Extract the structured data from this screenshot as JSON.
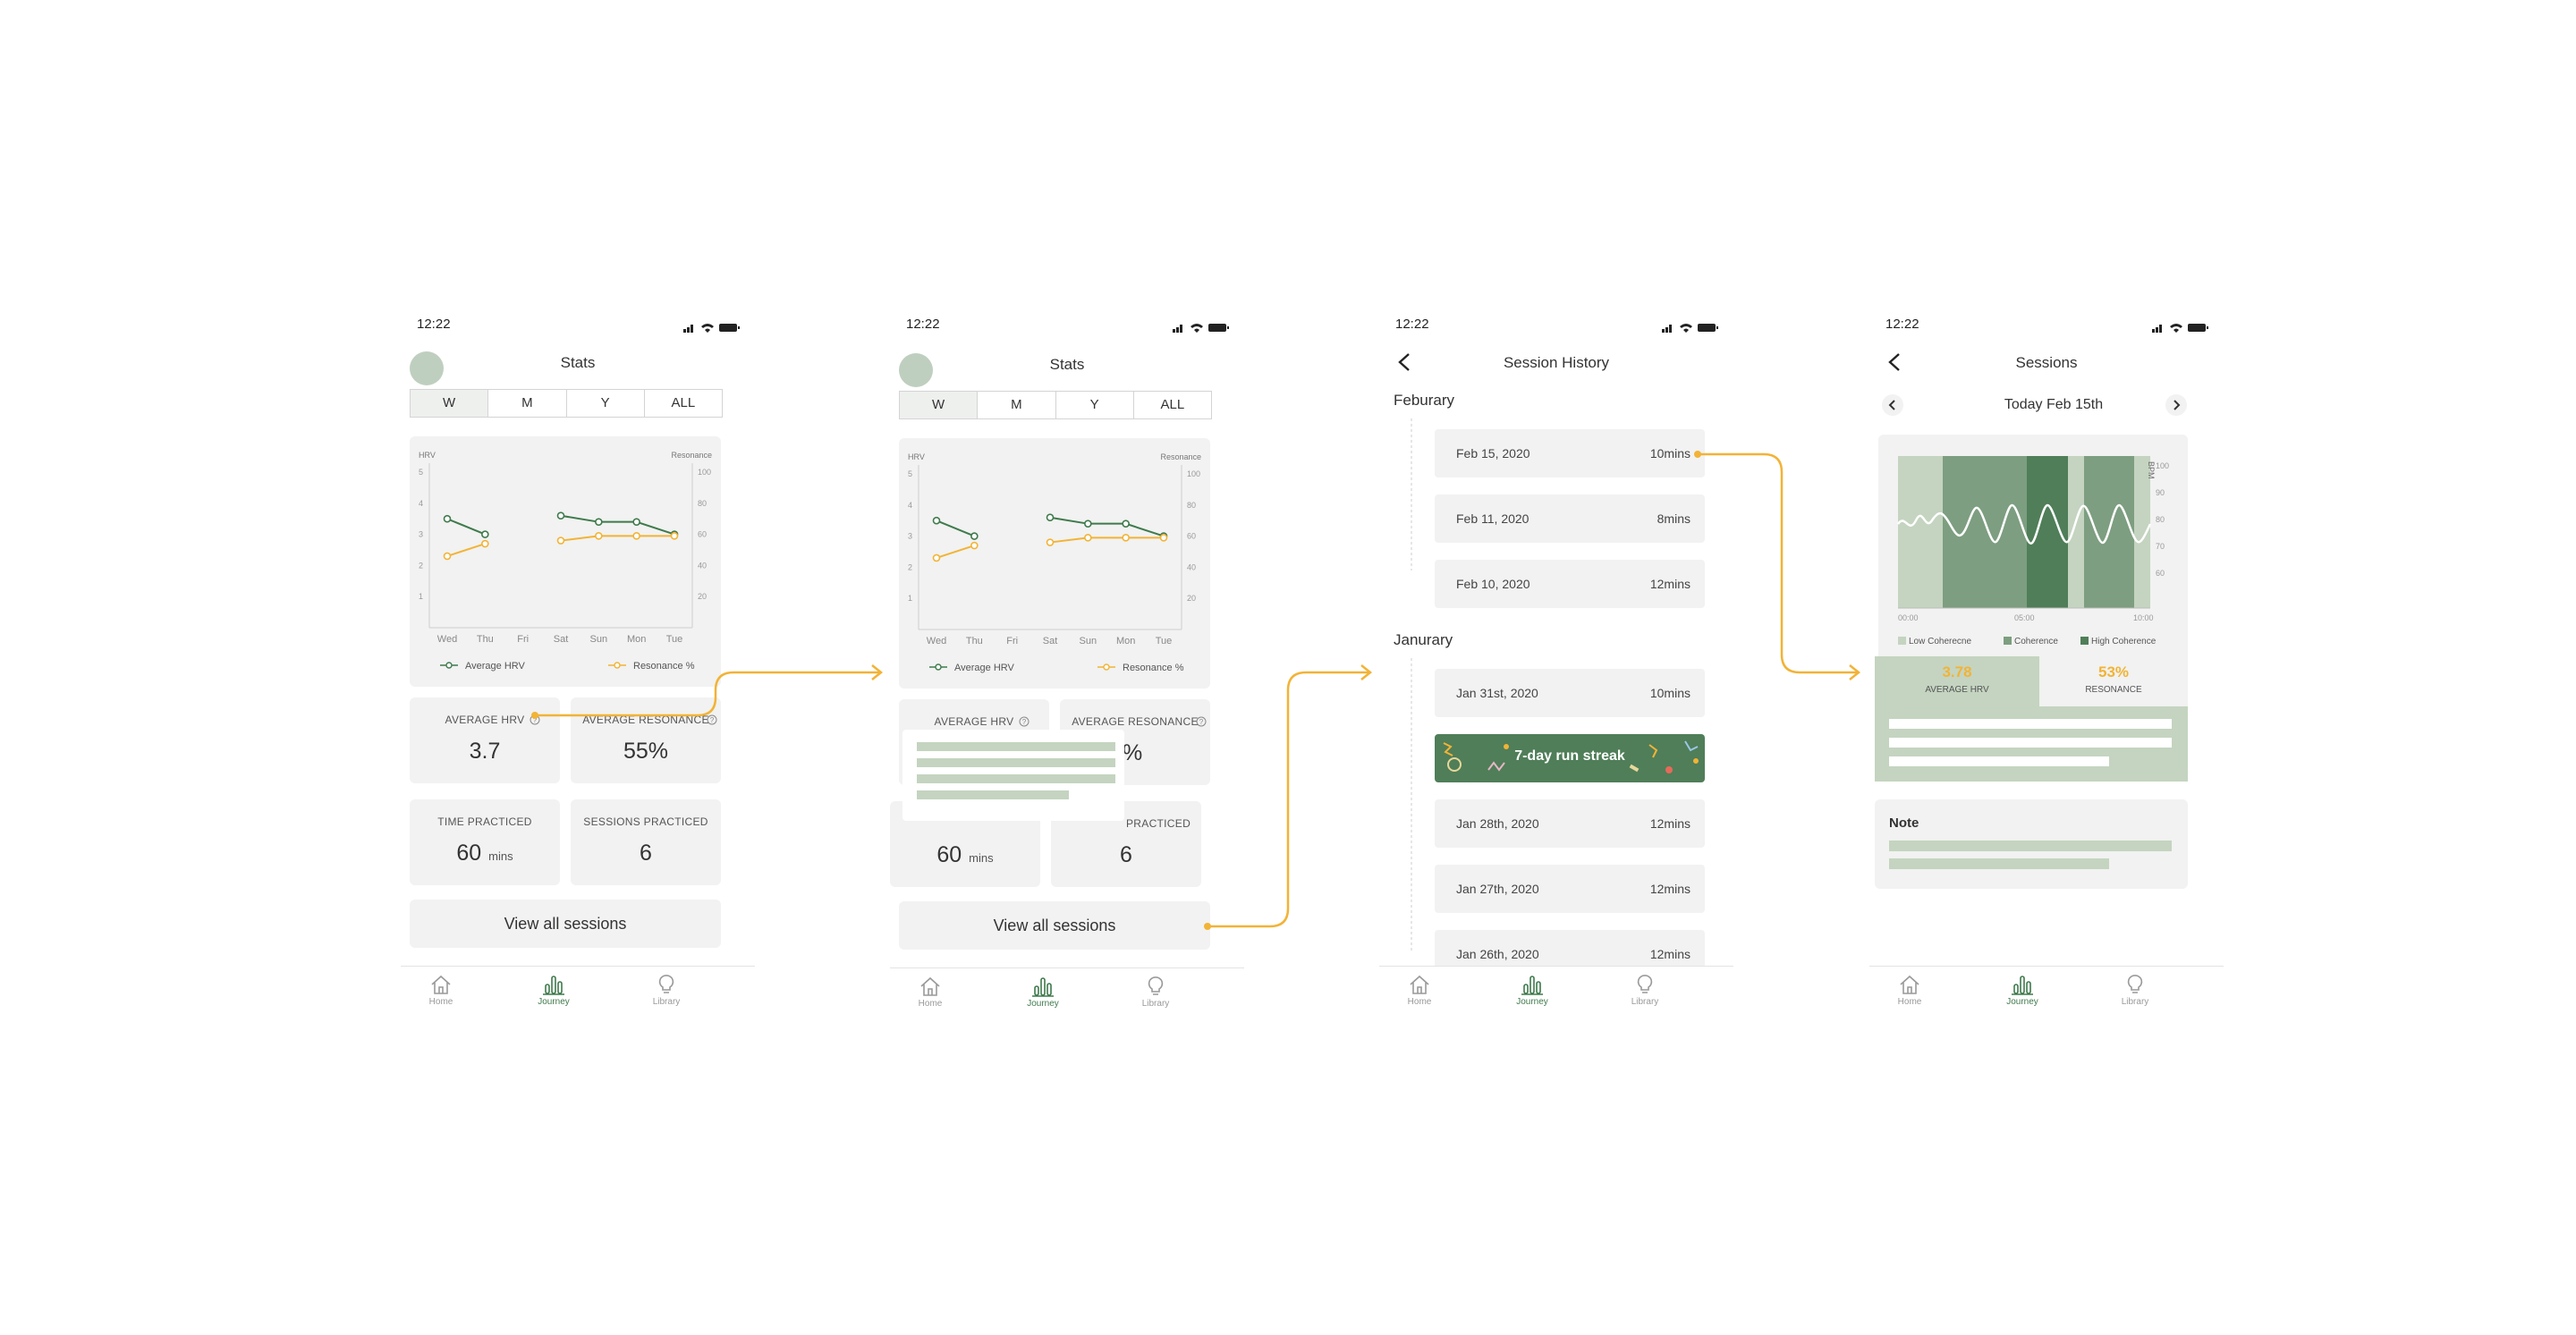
{
  "colors": {
    "accent": "#f2b336",
    "green": "#3f7a4c",
    "light_green": "#c4d4c0",
    "card": "#f1f2f1"
  },
  "status": {
    "time": "12:22"
  },
  "tabbar": {
    "home": "Home",
    "journey": "Journey",
    "library": "Library"
  },
  "stats": {
    "title": "Stats",
    "segments": [
      "W",
      "M",
      "Y",
      "ALL"
    ],
    "metrics": {
      "avg_hrv_label": "AVERAGE HRV",
      "avg_hrv_value": "3.7",
      "avg_res_label": "AVERAGE RESONANCE",
      "avg_res_value": "55%",
      "time_label": "TIME PRACTICED",
      "time_value": "60",
      "time_unit": "mins",
      "sessions_label": "SESSIONS PRACTICED",
      "sessions_value": "6"
    },
    "partial_res_value": "%",
    "partial_sessions_label": "PRACTICED",
    "view_all": "View all sessions"
  },
  "chart_data": {
    "type": "line",
    "x": [
      "Wed",
      "Thu",
      "Fri",
      "Sat",
      "Sun",
      "Mon",
      "Tue"
    ],
    "y_left_label": "HRV",
    "y_right_label": "Resonance",
    "y_left_ticks": [
      "1",
      "2",
      "3",
      "4",
      "5"
    ],
    "y_right_ticks": [
      "20",
      "40",
      "60",
      "80",
      "100"
    ],
    "ylim_left": [
      0,
      5
    ],
    "ylim_right": [
      0,
      100
    ],
    "series": [
      {
        "name": "Average HRV",
        "color": "#3f7a4c",
        "axis": "left",
        "segments": [
          [
            3.5,
            3.0,
            null,
            null,
            null,
            null,
            null
          ],
          [
            null,
            null,
            null,
            3.6,
            3.4,
            3.4,
            3.0
          ]
        ]
      },
      {
        "name": "Resonance %",
        "color": "#f2b336",
        "axis": "right",
        "segments": [
          [
            46,
            54,
            null,
            null,
            null,
            null,
            null
          ],
          [
            null,
            null,
            null,
            56,
            59,
            59,
            59
          ]
        ]
      }
    ],
    "legend": "bottom"
  },
  "history": {
    "title": "Session History",
    "feb_label": "Feburary",
    "jan_label": "Janurary",
    "feb": [
      {
        "date": "Feb 15, 2020",
        "mins": "10mins"
      },
      {
        "date": "Feb 11, 2020",
        "mins": "8mins"
      },
      {
        "date": "Feb 10, 2020",
        "mins": "12mins"
      }
    ],
    "jan": [
      {
        "date": "Jan 31st, 2020",
        "mins": "10mins"
      },
      {
        "date": "Jan 28th, 2020",
        "mins": "12mins"
      },
      {
        "date": "Jan 27th, 2020",
        "mins": "12mins"
      },
      {
        "date": "Jan 26th, 2020",
        "mins": "12mins"
      }
    ],
    "streak": "7-day run streak"
  },
  "session": {
    "title": "Sessions",
    "date": "Today Feb 15th",
    "x_ticks": [
      "00:00",
      "05:00",
      "10:00"
    ],
    "y_ticks": [
      "100",
      "90",
      "80",
      "70",
      "60"
    ],
    "y_label": "BPM",
    "legend": [
      "Low Coherecne",
      "Coherence",
      "High Coherence"
    ],
    "avg_hrv_value": "3.78",
    "avg_hrv_label": "AVERAGE HRV",
    "res_value": "53%",
    "res_label": "RESONANCE",
    "note_label": "Note"
  }
}
